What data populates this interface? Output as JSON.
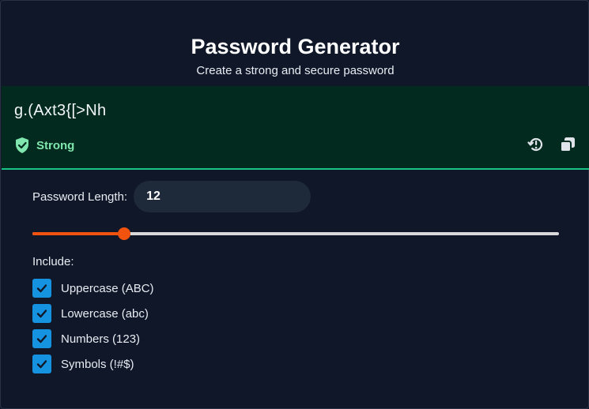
{
  "header": {
    "title": "Password Generator",
    "subtitle": "Create a strong and secure password"
  },
  "output": {
    "password": "g.(Axt3{[>Nh",
    "strength": "Strong",
    "strength_color": "#7fe6ae",
    "accent_border_color": "#19c384",
    "icons": [
      "shield-check-icon",
      "regenerate-icon",
      "copy-icon"
    ]
  },
  "length": {
    "label": "Password Length:",
    "value": "12",
    "min": 4,
    "max": 50,
    "slider_value": 12,
    "slider_color": "#f1530e"
  },
  "include": {
    "label": "Include:",
    "options": [
      {
        "label": "Uppercase (ABC)",
        "checked": true
      },
      {
        "label": "Lowercase (abc)",
        "checked": true
      },
      {
        "label": "Numbers (123)",
        "checked": true
      },
      {
        "label": "Symbols (!#$)",
        "checked": true
      }
    ],
    "checkbox_color": "#1593e0"
  }
}
